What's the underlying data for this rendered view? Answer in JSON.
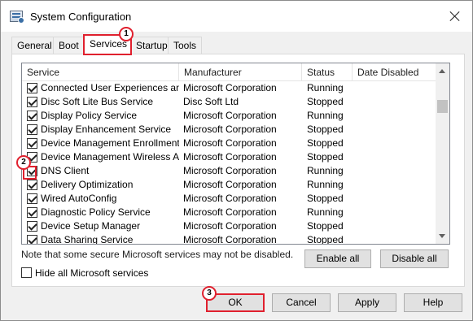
{
  "window": {
    "title": "System Configuration"
  },
  "tabs": [
    {
      "label": "General"
    },
    {
      "label": "Boot"
    },
    {
      "label": "Services"
    },
    {
      "label": "Startup"
    },
    {
      "label": "Tools"
    }
  ],
  "list": {
    "columns": [
      "Service",
      "Manufacturer",
      "Status",
      "Date Disabled"
    ],
    "rows": [
      {
        "name": "Connected User Experiences an...",
        "manufacturer": "Microsoft Corporation",
        "status": "Running",
        "checked": true
      },
      {
        "name": "Disc Soft Lite Bus Service",
        "manufacturer": "Disc Soft Ltd",
        "status": "Stopped",
        "checked": true
      },
      {
        "name": "Display Policy Service",
        "manufacturer": "Microsoft Corporation",
        "status": "Running",
        "checked": true
      },
      {
        "name": "Display Enhancement Service",
        "manufacturer": "Microsoft Corporation",
        "status": "Stopped",
        "checked": true
      },
      {
        "name": "Device Management Enrollment ...",
        "manufacturer": "Microsoft Corporation",
        "status": "Stopped",
        "checked": true
      },
      {
        "name": "Device Management Wireless Ap...",
        "manufacturer": "Microsoft Corporation",
        "status": "Stopped",
        "checked": true
      },
      {
        "name": "DNS Client",
        "manufacturer": "Microsoft Corporation",
        "status": "Running",
        "checked": true
      },
      {
        "name": "Delivery Optimization",
        "manufacturer": "Microsoft Corporation",
        "status": "Running",
        "checked": true
      },
      {
        "name": "Wired AutoConfig",
        "manufacturer": "Microsoft Corporation",
        "status": "Stopped",
        "checked": true
      },
      {
        "name": "Diagnostic Policy Service",
        "manufacturer": "Microsoft Corporation",
        "status": "Running",
        "checked": true
      },
      {
        "name": "Device Setup Manager",
        "manufacturer": "Microsoft Corporation",
        "status": "Stopped",
        "checked": true
      },
      {
        "name": "Data Sharing Service",
        "manufacturer": "Microsoft Corporation",
        "status": "Stopped",
        "checked": true
      }
    ]
  },
  "note": "Note that some secure Microsoft services may not be disabled.",
  "buttons": {
    "enable_all": "Enable all",
    "disable_all": "Disable all",
    "ok": "OK",
    "cancel": "Cancel",
    "apply": "Apply",
    "help": "Help"
  },
  "hide_ms": {
    "label": "Hide all Microsoft services",
    "checked": false
  },
  "markers": [
    "1",
    "2",
    "3"
  ],
  "colors": {
    "highlight": "#e0202e"
  }
}
